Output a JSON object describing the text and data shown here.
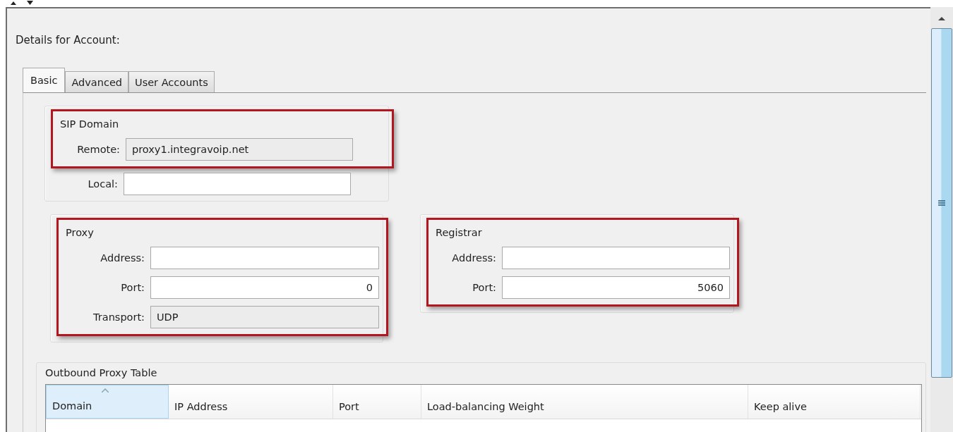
{
  "heading": "Details for Account:",
  "tabs": [
    {
      "label": "Basic",
      "selected": true
    },
    {
      "label": "Advanced",
      "selected": false
    },
    {
      "label": "User Accounts",
      "selected": false
    }
  ],
  "groups": [
    {
      "title": "SIP Domain",
      "highlighted": true,
      "highlight_all_rows": false,
      "fields": [
        {
          "label": "Remote:",
          "value": "proxy1.integravoip.net",
          "disabled": true,
          "kind": "text"
        },
        {
          "label": "Local:",
          "disabled": false,
          "kind": "text"
        }
      ]
    },
    {
      "title": "Proxy",
      "highlighted": true,
      "highlight_all_rows": true,
      "fields": [
        {
          "label": "Address:",
          "disabled": false,
          "kind": "text"
        },
        {
          "label": "Port:",
          "value": "0",
          "disabled": false,
          "kind": "number"
        },
        {
          "label": "Transport:",
          "value": "UDP",
          "disabled": true,
          "kind": "text"
        }
      ]
    },
    {
      "title": "Registrar",
      "highlighted": true,
      "highlight_all_rows": true,
      "fields": [
        {
          "label": "Address:",
          "disabled": false,
          "kind": "text"
        },
        {
          "label": "Port:",
          "value": "5060",
          "disabled": false,
          "kind": "number"
        }
      ]
    }
  ],
  "outbound_proxy_table": {
    "title": "Outbound Proxy Table",
    "columns": [
      {
        "label": "Domain",
        "selected": true
      },
      {
        "label": "IP Address",
        "selected": false
      },
      {
        "label": "Port",
        "selected": false
      },
      {
        "label": "Load-balancing Weight",
        "selected": false
      },
      {
        "label": "Keep alive",
        "selected": false
      }
    ]
  }
}
